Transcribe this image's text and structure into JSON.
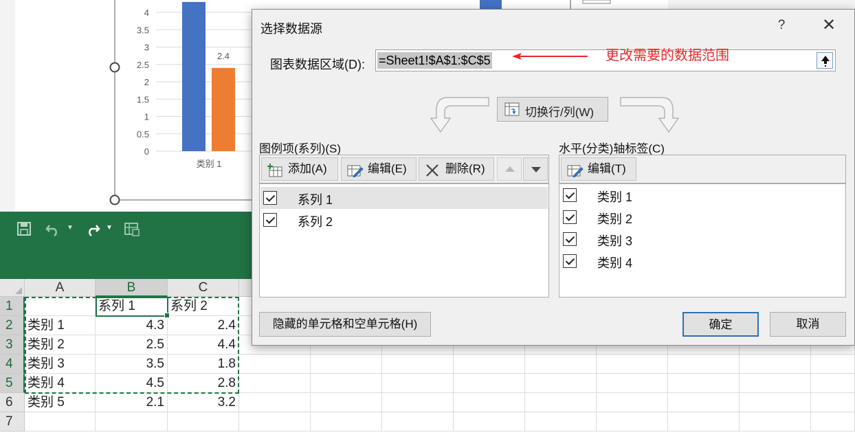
{
  "chart": {
    "y_ticks": [
      "0",
      "0.5",
      "1",
      "1.5",
      "2",
      "2.5",
      "3",
      "3.5",
      "4"
    ],
    "category_label": "类别 1",
    "data_label": "2.4",
    "colors": {
      "series1": "#4472c4",
      "series2": "#ed7d31"
    }
  },
  "chart_data": {
    "type": "bar",
    "categories": [
      "类别 1"
    ],
    "series": [
      {
        "values": [
          4.3
        ]
      },
      {
        "values": [
          2.4
        ]
      }
    ],
    "ylim": [
      0,
      4.5
    ],
    "data_labels": [
      "2.4"
    ],
    "grid": true
  },
  "ribbon": {
    "color": "#217346",
    "icons": [
      "save-icon",
      "undo-icon",
      "redo-icon",
      "table-icon"
    ]
  },
  "sheet": {
    "columns": [
      "A",
      "B",
      "C"
    ],
    "rows": [
      {
        "num": "1",
        "a": "",
        "b": "系列 1",
        "c": "系列 2"
      },
      {
        "num": "2",
        "a": "类别 1",
        "b": "4.3",
        "c": "2.4"
      },
      {
        "num": "3",
        "a": "类别 2",
        "b": "2.5",
        "c": "4.4"
      },
      {
        "num": "4",
        "a": "类别 3",
        "b": "3.5",
        "c": "1.8"
      },
      {
        "num": "5",
        "a": "类别 4",
        "b": "4.5",
        "c": "2.8"
      },
      {
        "num": "6",
        "a": "类别 5",
        "b": "2.1",
        "c": "3.2"
      },
      {
        "num": "7",
        "a": "",
        "b": "",
        "c": ""
      }
    ]
  },
  "dialog": {
    "title": "选择数据源",
    "help": "?",
    "close": "✕",
    "range_label": "图表数据区域(D):",
    "range_value": "=Sheet1!$A$1:$C$5",
    "annotation": "更改需要的数据范围",
    "switch_label": "切换行/列(W)",
    "legend": {
      "label": "图例项(系列)(S)",
      "add": "添加(A)",
      "edit": "编辑(E)",
      "delete": "删除(R)",
      "items": [
        "系列 1",
        "系列 2"
      ]
    },
    "axis": {
      "label": "水平(分类)轴标签(C)",
      "edit": "编辑(T)",
      "items": [
        "类别 1",
        "类别 2",
        "类别 3",
        "类别 4"
      ]
    },
    "hidden_cells": "隐藏的单元格和空单元格(H)",
    "ok": "确定",
    "cancel": "取消"
  }
}
